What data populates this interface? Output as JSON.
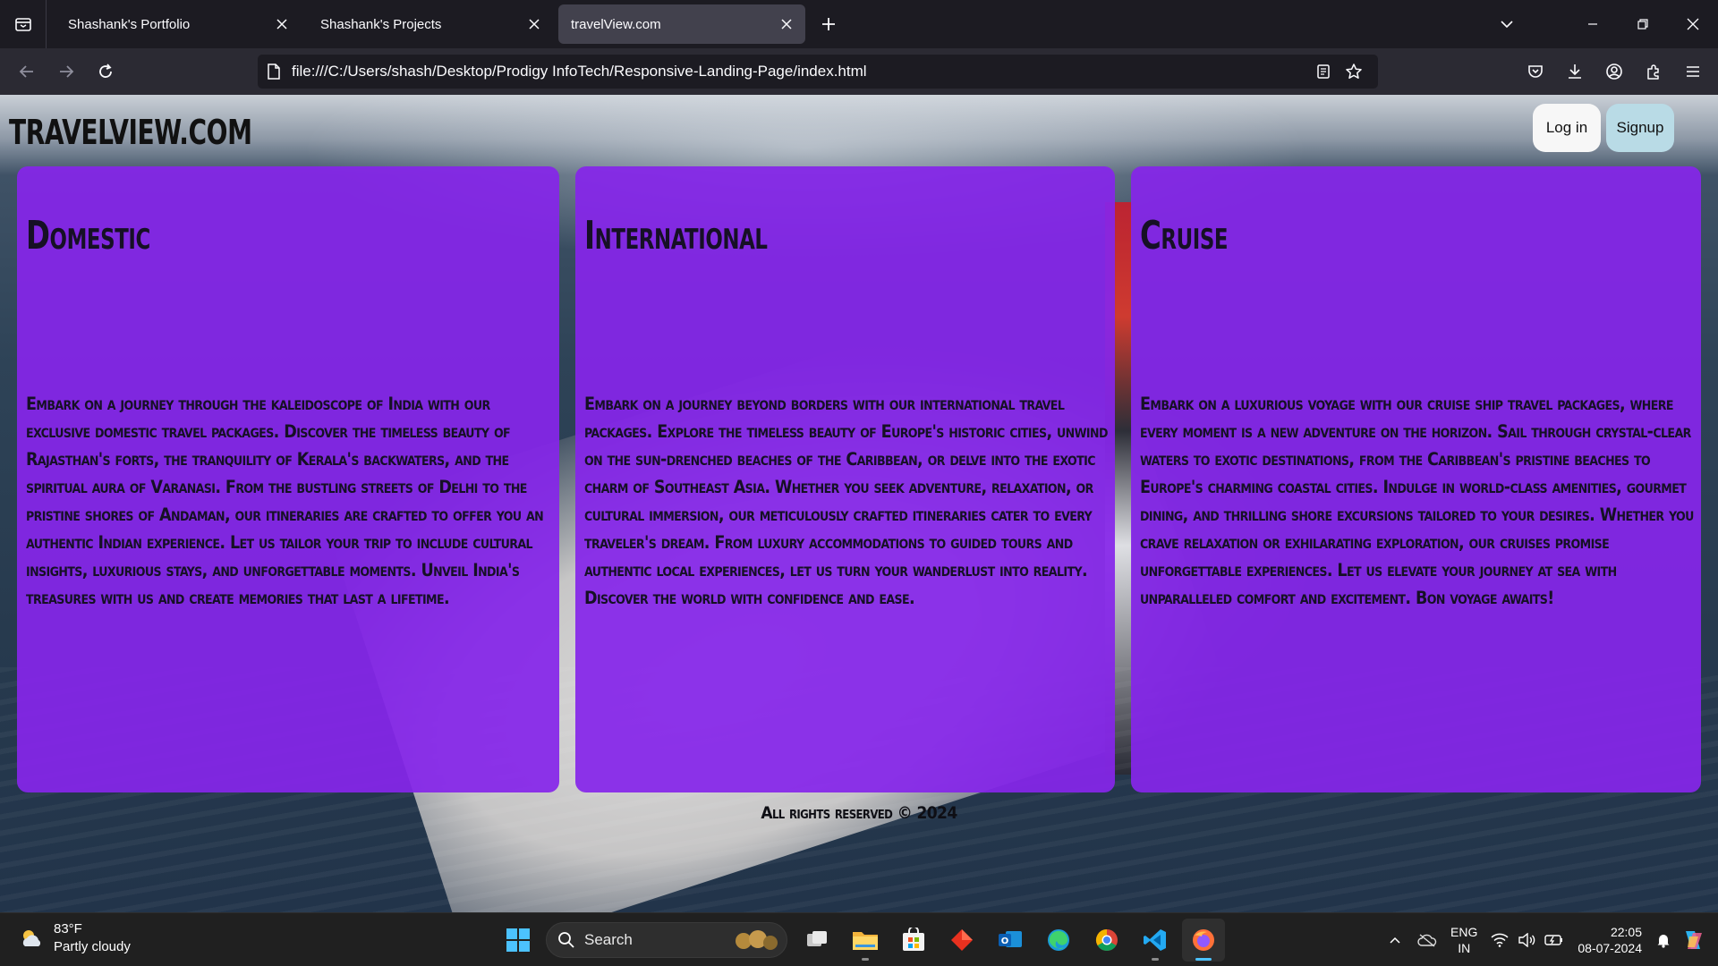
{
  "browser": {
    "tabs": [
      {
        "title": "Shashank's Portfolio",
        "active": false
      },
      {
        "title": "Shashank's Projects",
        "active": false
      },
      {
        "title": "travelView.com",
        "active": true
      }
    ],
    "url": "file:///C:/Users/shash/Desktop/Prodigy InfoTech/Responsive-Landing-Page/index.html"
  },
  "page": {
    "logo": "TRAVELVIEW.COM",
    "login_label": "Log in",
    "signup_label": "Signup",
    "cards": [
      {
        "title": "Domestic",
        "body": "Embark on a journey through the kaleidoscope of India with our exclusive domestic travel packages. Discover the timeless beauty of Rajasthan's forts, the tranquility of Kerala's backwaters, and the spiritual aura of Varanasi. From the bustling streets of Delhi to the pristine shores of Andaman, our itineraries are crafted to offer you an authentic Indian experience. Let us tailor your trip to include cultural insights, luxurious stays, and unforgettable moments. Unveil India's treasures with us and create memories that last a lifetime."
      },
      {
        "title": "International",
        "body": "Embark on a journey beyond borders with our international travel packages. Explore the timeless beauty of Europe's historic cities, unwind on the sun-drenched beaches of the Caribbean, or delve into the exotic charm of Southeast Asia. Whether you seek adventure, relaxation, or cultural immersion, our meticulously crafted itineraries cater to every traveler's dream. From luxury accommodations to guided tours and authentic local experiences, let us turn your wanderlust into reality. Discover the world with confidence and ease."
      },
      {
        "title": "Cruise",
        "body": "Embark on a luxurious voyage with our cruise ship travel packages, where every moment is a new adventure on the horizon. Sail through crystal-clear waters to exotic destinations, from the Caribbean's pristine beaches to Europe's charming coastal cities. Indulge in world-class amenities, gourmet dining, and thrilling shore excursions tailored to your desires. Whether you crave relaxation or exhilarating exploration, our cruises promise unforgettable experiences. Let us elevate your journey at sea with unparalleled comfort and excitement. Bon voyage awaits!"
      }
    ],
    "footer": "All rights reserved © 2024"
  },
  "taskbar": {
    "weather_temp": "83°F",
    "weather_desc": "Partly cloudy",
    "search_label": "Search",
    "lang_line1": "ENG",
    "lang_line2": "IN",
    "time": "22:05",
    "date": "08-07-2024",
    "pinned": [
      "task-view-icon",
      "file-explorer-icon",
      "microsoft-store-icon",
      "app-red-diamond-icon",
      "outlook-icon",
      "edge-icon",
      "chrome-icon",
      "vscode-icon",
      "firefox-icon"
    ]
  },
  "colors": {
    "card_bg": "#8526ea",
    "login_bg": "#f7f7f7",
    "signup_bg": "#b9dbe6",
    "accent": "#4cc2ff"
  }
}
